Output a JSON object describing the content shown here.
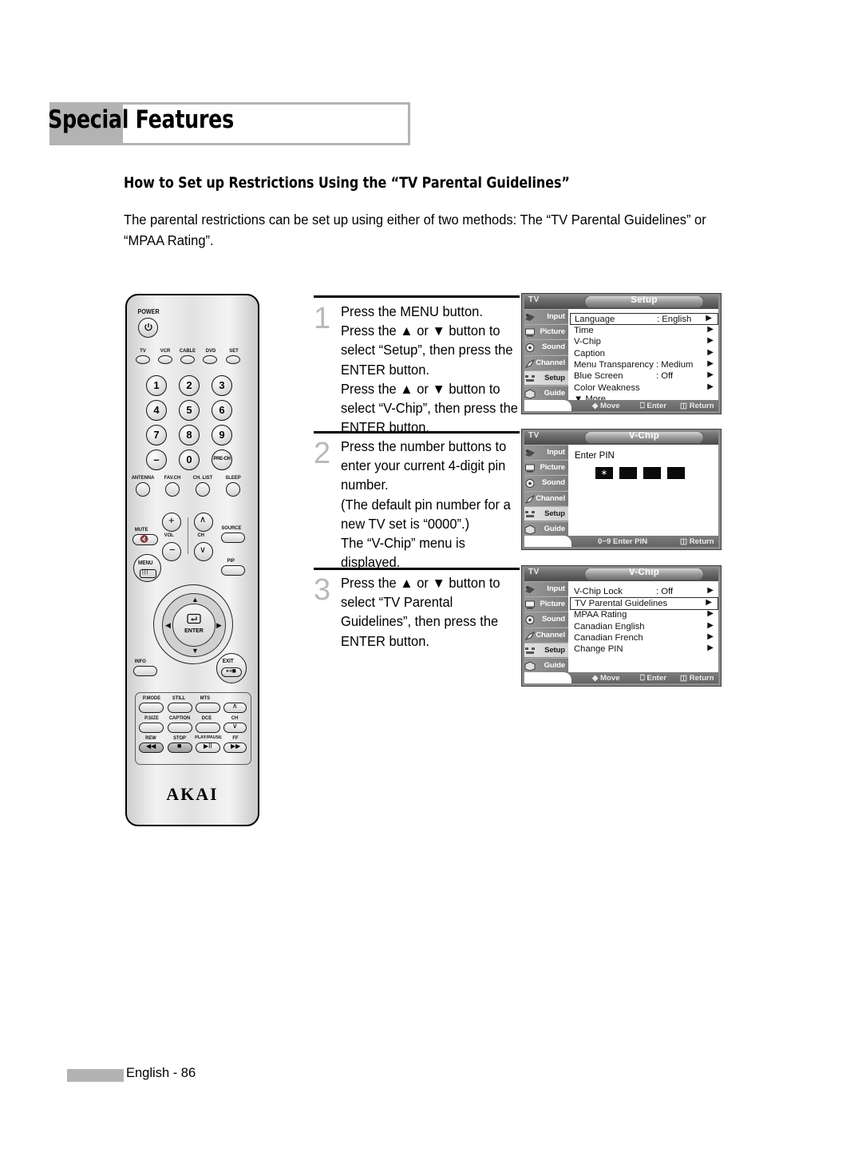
{
  "page": {
    "title": "Special Features",
    "section_heading": "How to Set up Restrictions Using the “TV Parental Guidelines”",
    "intro": "The parental restrictions can be set up using either of two methods: The “TV Parental Guidelines” or “MPAA Rating”.",
    "footer": "English - 86",
    "accent_gray": "#b3b3b3"
  },
  "steps": [
    {
      "number": "1",
      "text": "Press the MENU button.\nPress the ▲ or ▼ button to select “Setup”, then press the ENTER button.\nPress the ▲ or ▼ button to select “V-Chip”, then press the ENTER button."
    },
    {
      "number": "2",
      "text": "Press the number buttons to enter your current 4-digit pin number.\n(The default pin number for a new TV set is “0000”.)\nThe “V-Chip” menu is displayed."
    },
    {
      "number": "3",
      "text": "Press the ▲ or ▼ button to select “TV Parental Guidelines”, then press the ENTER button."
    }
  ],
  "osd_sidebar": [
    {
      "label": "Input",
      "icon": "input-icon",
      "active": false
    },
    {
      "label": "Picture",
      "icon": "picture-icon",
      "active": false
    },
    {
      "label": "Sound",
      "icon": "sound-icon",
      "active": false
    },
    {
      "label": "Channel",
      "icon": "channel-icon",
      "active": false
    },
    {
      "label": "Setup",
      "icon": "setup-icon",
      "active": true
    },
    {
      "label": "Guide",
      "icon": "guide-icon",
      "active": false
    }
  ],
  "osd_screens": [
    {
      "source_label": "TV",
      "title": "Setup",
      "rows": [
        {
          "label": "Language",
          "value": ": English",
          "arrow": "▶",
          "selected": true
        },
        {
          "label": "Time",
          "value": "",
          "arrow": "▶",
          "selected": false
        },
        {
          "label": "V-Chip",
          "value": "",
          "arrow": "▶",
          "selected": false
        },
        {
          "label": "Caption",
          "value": "",
          "arrow": "▶",
          "selected": false
        },
        {
          "label": "Menu Transparency",
          "value": ": Medium",
          "arrow": "▶",
          "selected": false
        },
        {
          "label": "Blue Screen",
          "value": ": Off",
          "arrow": "▶",
          "selected": false
        },
        {
          "label": "Color Weakness",
          "value": "",
          "arrow": "▶",
          "selected": false
        },
        {
          "label": "▼ More",
          "value": "",
          "arrow": "",
          "selected": false
        }
      ],
      "hints": [
        {
          "icon": "↕",
          "text": "Move"
        },
        {
          "icon": "⏎",
          "text": "Enter"
        },
        {
          "icon": "⧉",
          "text": "Return"
        }
      ]
    },
    {
      "source_label": "TV",
      "title": "V-Chip",
      "pin_prompt": "Enter PIN",
      "pin_boxes": [
        {
          "filled": true,
          "glyph": "∗"
        },
        {
          "filled": false,
          "glyph": ""
        },
        {
          "filled": false,
          "glyph": ""
        },
        {
          "filled": false,
          "glyph": ""
        }
      ],
      "rows": [],
      "hints": [
        {
          "icon": "",
          "text": "0~9 Enter PIN"
        },
        {
          "icon": "⧉",
          "text": "Return"
        }
      ]
    },
    {
      "source_label": "TV",
      "title": "V-Chip",
      "rows": [
        {
          "label": "V-Chip Lock",
          "value": ": Off",
          "arrow": "▶",
          "selected": false
        },
        {
          "label": "TV Parental Guidelines",
          "value": "",
          "arrow": "▶",
          "selected": true
        },
        {
          "label": "MPAA Rating",
          "value": "",
          "arrow": "▶",
          "selected": false
        },
        {
          "label": "Canadian English",
          "value": "",
          "arrow": "▶",
          "selected": false
        },
        {
          "label": "Canadian French",
          "value": "",
          "arrow": "▶",
          "selected": false
        },
        {
          "label": "Change PIN",
          "value": "",
          "arrow": "▶",
          "selected": false
        }
      ],
      "hints": [
        {
          "icon": "↕",
          "text": "Move"
        },
        {
          "icon": "⏎",
          "text": "Enter"
        },
        {
          "icon": "⧉",
          "text": "Return"
        }
      ]
    }
  ],
  "remote": {
    "brand": "AKAI",
    "power_label": "POWER",
    "device_buttons": [
      "TV",
      "VCR",
      "CABLE",
      "DVD",
      "SET"
    ],
    "number_buttons": [
      "1",
      "2",
      "3",
      "4",
      "5",
      "6",
      "7",
      "8",
      "9",
      "–",
      "0",
      "PRE-CH"
    ],
    "function_row": [
      "ANTENNA",
      "FAV.CH",
      "CH. LIST",
      "SLEEP"
    ],
    "mute_label": "MUTE",
    "vol_label": "VOL",
    "ch_label": "CH",
    "source_label": "SOURCE",
    "menu_label": "MENU",
    "pip_label": "PIP",
    "enter_label": "ENTER",
    "info_label": "INFO",
    "exit_label": "EXIT",
    "media_labels_row1": [
      "P.MODE",
      "STILL",
      "MTS"
    ],
    "media_labels_row2": [
      "P.SIZE",
      "CAPTION",
      "DCE"
    ],
    "media_labels_row3": [
      "REW",
      "STOP",
      "PLAY/PAUSE",
      "FF"
    ],
    "media_ch_label": "CH",
    "media_glyphs": [
      "◀◀",
      "■",
      "▶II",
      "▶▶"
    ]
  }
}
